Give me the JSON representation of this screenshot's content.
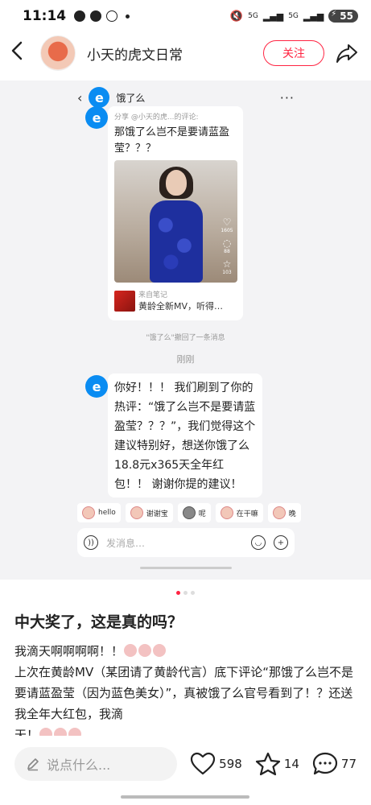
{
  "status_bar": {
    "time": "11:14",
    "network_1": "5G",
    "network_2": "5G",
    "battery": "55"
  },
  "header": {
    "author_name": "小天的虎文日常",
    "follow_label": "关注"
  },
  "chat": {
    "title": "饿了么",
    "share_meta": "分享 @小天的虎...的评论:",
    "share_text": "那饿了么岂不是要请蓝盈莹？？？",
    "likes": "1605",
    "comments": "88",
    "stars": "103",
    "source_label": "来自笔记",
    "source_desc": "黄龄全新MV，听得…",
    "recall_note": "\"饿了么\"撤回了一条消息",
    "time_note": "刚刚",
    "reply_text": "你好！！！ 我们刷到了你的热评：“饿了么岂不是要请蓝盈莹？？？”，我们觉得这个建议特别好，想送你饿了么18.8元x365天全年红包！！ 谢谢你提的建议！",
    "quick_replies": [
      "hello",
      "谢谢宝",
      "呢",
      "在干嘛",
      "晚"
    ],
    "input_placeholder": "发消息…"
  },
  "post": {
    "title": "中大奖了，这是真的吗？",
    "body_line1": "我滴天啊啊啊啊！！",
    "body_line2": "上次在黄龄MV（某团请了黄龄代言）底下评论“那饿了么岂不是要请蓝盈莹（因为蓝色美女）”，真被饿了么官号看到了！？还送我全年大红包，我滴",
    "body_line3": "天！"
  },
  "bottom_bar": {
    "comment_placeholder": "说点什么...",
    "likes": "598",
    "stars": "14",
    "comments": "77"
  },
  "colors": {
    "accent": "#ff2442",
    "eleme_blue": "#0a8cf2"
  }
}
